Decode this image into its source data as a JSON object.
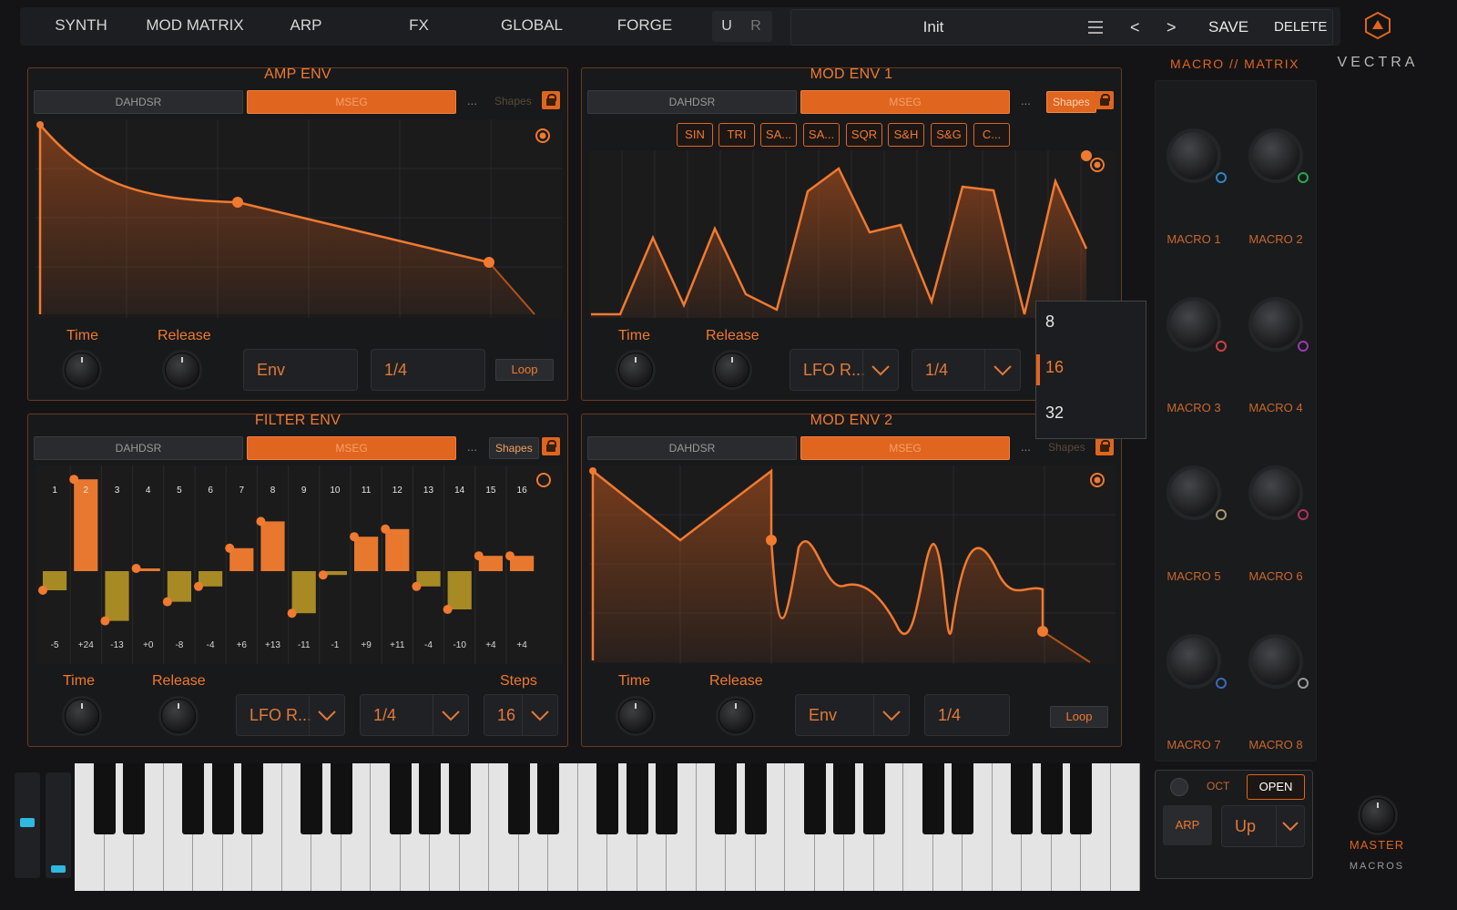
{
  "top_tabs": [
    "SYNTH",
    "MOD MATRIX",
    "ARP",
    "FX",
    "GLOBAL",
    "FORGE"
  ],
  "undo": "U",
  "redo": "R",
  "preset": {
    "name": "Init",
    "prev": "<",
    "next": ">",
    "save": "SAVE",
    "delete": "DELETE"
  },
  "brand": "VECTRA",
  "panels": {
    "amp_env": {
      "title": "AMP ENV",
      "mode_a": "DAHDSR",
      "mode_b": "MSEG",
      "dots": "...",
      "shapes": "Shapes",
      "time": "Time",
      "release": "Release",
      "source": "Env",
      "rate": "1/4",
      "loop": "Loop"
    },
    "mod_env1": {
      "title": "MOD ENV 1",
      "mode_a": "DAHDSR",
      "mode_b": "MSEG",
      "dots": "...",
      "shapes": "Shapes",
      "shape_buttons": [
        "SIN",
        "TRI",
        "SA...",
        "SA...",
        "SQR",
        "S&H",
        "S&G",
        "C..."
      ],
      "time": "Time",
      "release": "Release",
      "source": "LFO R...",
      "rate": "1/4"
    },
    "filter_env": {
      "title": "FILTER ENV",
      "mode_a": "DAHDSR",
      "mode_b": "MSEG",
      "dots": "...",
      "shapes": "Shapes",
      "step_numbers": [
        "1",
        "2",
        "3",
        "4",
        "5",
        "6",
        "7",
        "8",
        "9",
        "10",
        "11",
        "12",
        "13",
        "14",
        "15",
        "16"
      ],
      "step_values": [
        "-5",
        "+24",
        "-13",
        "+0",
        "-8",
        "-4",
        "+6",
        "+13",
        "-11",
        "-1",
        "+9",
        "+11",
        "-4",
        "-10",
        "+4",
        "+4"
      ],
      "time": "Time",
      "release": "Release",
      "source": "LFO R...",
      "rate": "1/4",
      "steps_label": "Steps",
      "steps": "16"
    },
    "mod_env2": {
      "title": "MOD ENV 2",
      "mode_a": "DAHDSR",
      "mode_b": "MSEG",
      "dots": "...",
      "shapes": "Shapes",
      "time": "Time",
      "release": "Release",
      "source": "Env",
      "rate": "1/4",
      "loop": "Loop"
    }
  },
  "steps_dropdown": {
    "options": [
      "8",
      "16",
      "32"
    ],
    "selected": "16"
  },
  "macro_matrix": {
    "title": "MACRO // MATRIX",
    "macros": [
      "MACRO 1",
      "MACRO 2",
      "MACRO 3",
      "MACRO 4",
      "MACRO 5",
      "MACRO 6",
      "MACRO 7",
      "MACRO 8"
    ],
    "dot_colors": [
      "#2a86c8",
      "#2aa84a",
      "#d04040",
      "#9a3ab0",
      "#a89a6a",
      "#b03060",
      "#3a6ab8",
      "#9a9a9a"
    ]
  },
  "arp": {
    "oct": "OCT",
    "open": "OPEN",
    "arp": "ARP",
    "direction": "Up"
  },
  "master": {
    "label": "MASTER",
    "macros": "MACROS"
  },
  "colors": {
    "accent": "#e0651f",
    "accent_text": "#f07a30",
    "bg": "#141416"
  }
}
